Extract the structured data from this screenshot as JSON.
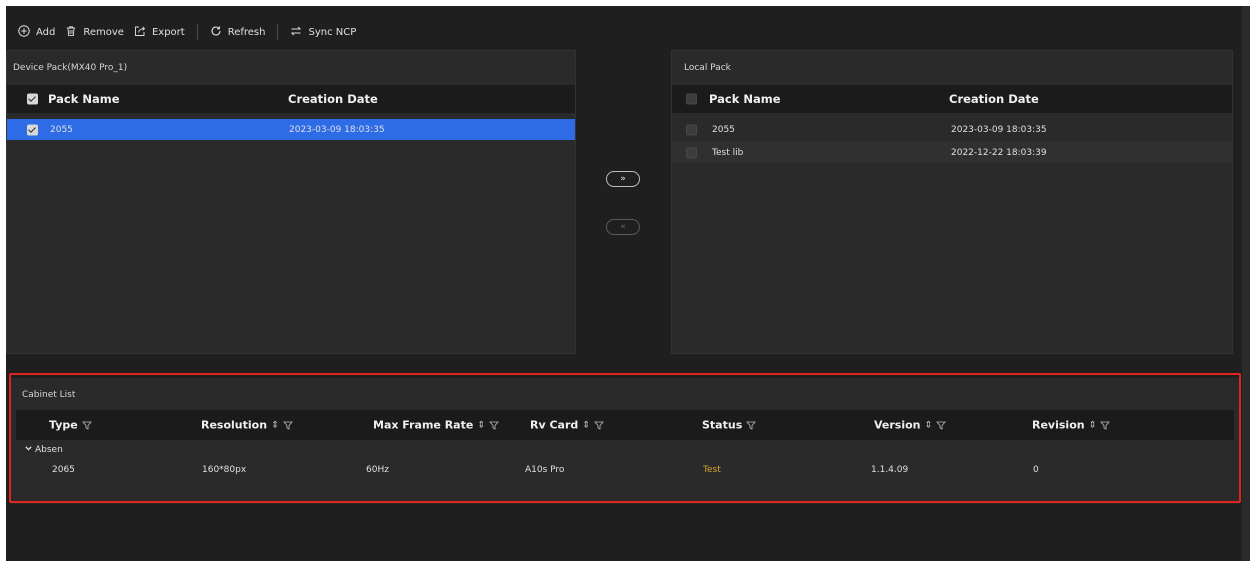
{
  "toolbar": {
    "add": "Add",
    "remove": "Remove",
    "export": "Export",
    "refresh": "Refresh",
    "sync": "Sync NCP"
  },
  "device_pack": {
    "title": "Device Pack(MX40 Pro_1)",
    "columns": [
      "Pack Name",
      "Creation Date"
    ],
    "rows": [
      {
        "name": "2055",
        "date": "2023-03-09 18:03:35",
        "selected": true
      }
    ]
  },
  "transfer": {
    "to_local": "»",
    "to_device": "«"
  },
  "local_pack": {
    "title": "Local Pack",
    "columns": [
      "Pack Name",
      "Creation Date"
    ],
    "rows": [
      {
        "name": "2055",
        "date": "2023-03-09 18:03:35"
      },
      {
        "name": "Test lib",
        "date": "2022-12-22 18:03:39"
      }
    ]
  },
  "cabinet_list": {
    "title": "Cabinet List",
    "columns": [
      "Type",
      "Resolution",
      "Max Frame Rate",
      "Rv Card",
      "Status",
      "Version",
      "Revision"
    ],
    "sort_glyph": "⇕",
    "group": "Absen",
    "rows": [
      {
        "type": "2065",
        "resolution": "160*80px",
        "frame_rate": "60Hz",
        "rv_card": "A10s Pro",
        "status": "Test",
        "version": "1.1.4.09",
        "revision": "0"
      }
    ]
  },
  "colors": {
    "selection": "#2e6be6",
    "status_test": "#d7a52a",
    "highlight_border": "#e2241f"
  }
}
